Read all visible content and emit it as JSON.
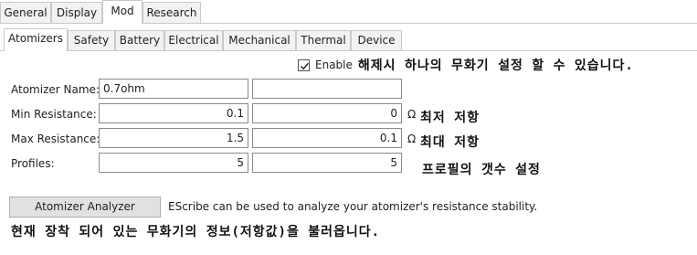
{
  "main_tabs": [
    {
      "label": "General",
      "active": false
    },
    {
      "label": "Display",
      "active": false
    },
    {
      "label": "Mod",
      "active": true
    },
    {
      "label": "Research",
      "active": false
    }
  ],
  "sub_tabs": [
    {
      "label": "Atomizers",
      "active": true
    },
    {
      "label": "Safety",
      "active": false
    },
    {
      "label": "Battery",
      "active": false
    },
    {
      "label": "Electrical",
      "active": false
    },
    {
      "label": "Mechanical",
      "active": false
    },
    {
      "label": "Thermal",
      "active": false
    },
    {
      "label": "Device",
      "active": false
    }
  ],
  "enable": {
    "label": "Enable",
    "checked": true,
    "note": "해제시 하나의 무화기 설정 할 수 있습니다."
  },
  "form": {
    "atomizer_name": {
      "label": "Atomizer Name:",
      "value1": "0.7ohm",
      "value2": ""
    },
    "min_resistance": {
      "label": "Min Resistance:",
      "value1": "0.1",
      "value2": "0",
      "unit": "Ω",
      "note": "최저 저항"
    },
    "max_resistance": {
      "label": "Max Resistance:",
      "value1": "1.5",
      "value2": "0.1",
      "unit": "Ω",
      "note": "최대 저항"
    },
    "profiles": {
      "label": "Profiles:",
      "value1": "5",
      "value2": "5",
      "note": "프로필의 갯수 설정"
    }
  },
  "analyzer": {
    "button_label": "Atomizer Analyzer",
    "description": "EScribe can be used to analyze your atomizer's resistance stability.",
    "note": "현재 장착 되어 있는 무화기의 정보(저항값)을 불러옵니다."
  }
}
